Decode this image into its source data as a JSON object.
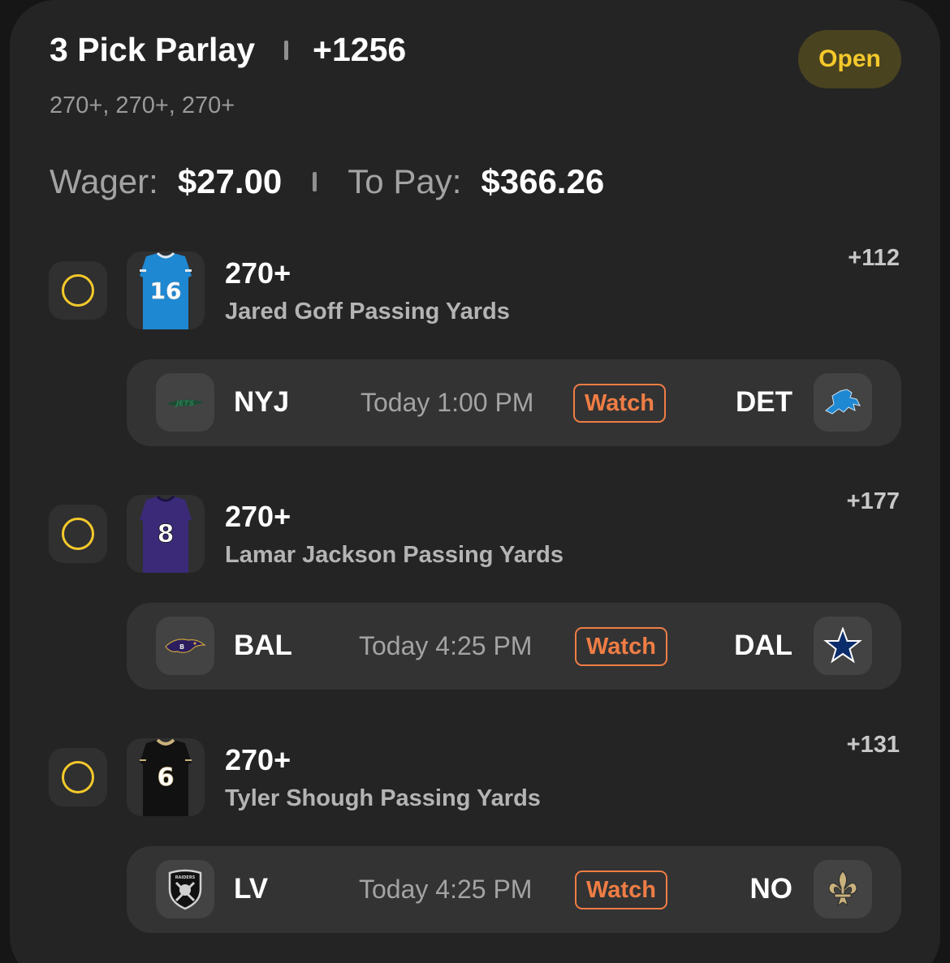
{
  "header": {
    "title": "3 Pick Parlay",
    "odds": "+1256",
    "subtitle": "270+, 270+, 270+",
    "status": "Open"
  },
  "wager": {
    "wager_label": "Wager:",
    "wager_value": "$27.00",
    "payout_label": "To Pay:",
    "payout_value": "$366.26"
  },
  "legs": [
    {
      "line": "270+",
      "market": "Jared Goff Passing Yards",
      "odds": "+112",
      "jersey_number": "16",
      "away_team": "NYJ",
      "home_team": "DET",
      "time": "Today 1:00 PM",
      "watch_label": "Watch",
      "away_logo": "jets-logo-icon",
      "home_logo": "lions-logo-icon"
    },
    {
      "line": "270+",
      "market": "Lamar Jackson Passing Yards",
      "odds": "+177",
      "jersey_number": "8",
      "away_team": "BAL",
      "home_team": "DAL",
      "time": "Today 4:25 PM",
      "watch_label": "Watch",
      "away_logo": "ravens-logo-icon",
      "home_logo": "cowboys-star-icon"
    },
    {
      "line": "270+",
      "market": "Tyler Shough Passing Yards",
      "odds": "+131",
      "jersey_number": "6",
      "away_team": "LV",
      "home_team": "NO",
      "time": "Today 4:25 PM",
      "watch_label": "Watch",
      "away_logo": "raiders-shield-icon",
      "home_logo": "fleur-de-lis-icon"
    }
  ],
  "colors": {
    "accent_yellow": "#f4c92b",
    "watch_orange": "#ef7d45",
    "lions_blue": "#1e88d2",
    "ravens_purple": "#3a2a78",
    "saints_black": "#111111",
    "saints_gold": "#c9b27c"
  }
}
